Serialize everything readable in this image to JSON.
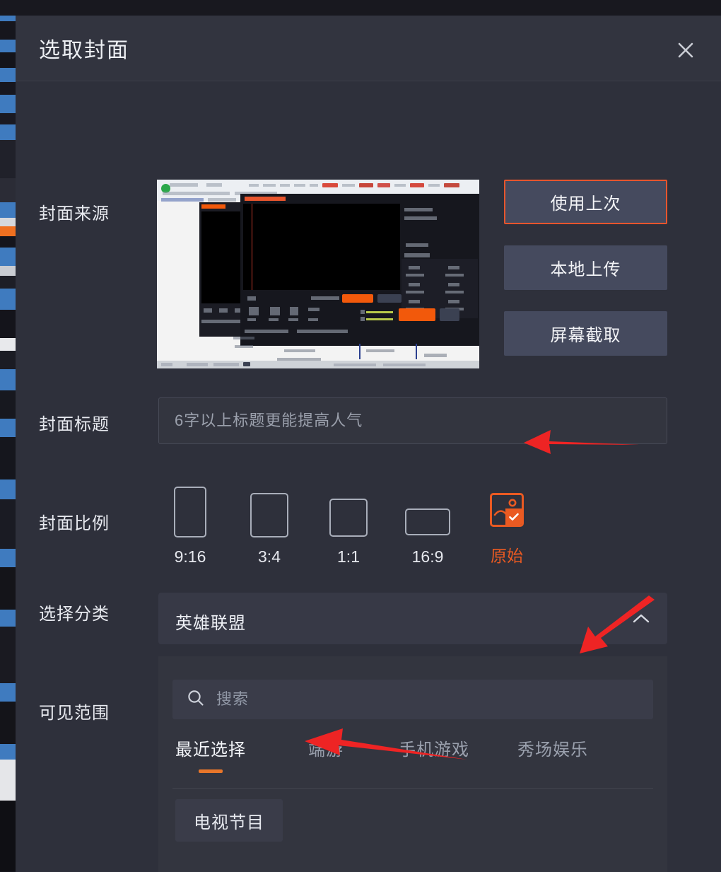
{
  "dialog": {
    "title": "选取封面",
    "close_icon": "close-icon"
  },
  "rows": {
    "cover_source_label": "封面来源",
    "cover_title_label": "封面标题",
    "cover_ratio_label": "封面比例",
    "category_label": "选择分类",
    "visibility_label": "可见范围"
  },
  "cover_source": {
    "buttons": [
      {
        "label": "使用上次",
        "selected": true
      },
      {
        "label": "本地上传",
        "selected": false
      },
      {
        "label": "屏幕截取",
        "selected": false
      }
    ],
    "preview_alt": "直播推流软件截图预览"
  },
  "cover_title": {
    "value": "",
    "placeholder": "6字以上标题更能提高人气"
  },
  "cover_ratio": {
    "options": [
      {
        "label": "9:16",
        "selected": false
      },
      {
        "label": "3:4",
        "selected": false
      },
      {
        "label": "1:1",
        "selected": false
      },
      {
        "label": "16:9",
        "selected": false
      },
      {
        "label": "原始",
        "selected": true
      }
    ]
  },
  "category": {
    "selected": "英雄联盟",
    "chevron_icon": "chevron-up-icon",
    "search": {
      "placeholder": "搜索",
      "value": "",
      "icon": "search-icon"
    },
    "tabs": [
      {
        "label": "最近选择",
        "active": true
      },
      {
        "label": "端游",
        "active": false
      },
      {
        "label": "手机游戏",
        "active": false
      },
      {
        "label": "秀场娱乐",
        "active": false
      }
    ],
    "items": [
      {
        "label": "电视节目",
        "selected": false
      }
    ]
  },
  "annotations": {
    "arrow_ratio": "red-arrow-pointing-left-at-original-ratio",
    "arrow_tabs": "red-arrow-pointing-down-left-at-category-tabs",
    "arrow_item": "red-arrow-pointing-left-at-tv-program-item"
  },
  "colors": {
    "accent_orange": "#e8552d",
    "tab_underline": "#e8762a",
    "dialog_bg": "#2e303b",
    "header_bg": "#32343f",
    "panel_bg": "#33353f",
    "button_bg": "#454a5e",
    "text_primary": "#eef0f4",
    "text_muted": "#9aa0ad",
    "arrow_red": "#ee2424"
  }
}
